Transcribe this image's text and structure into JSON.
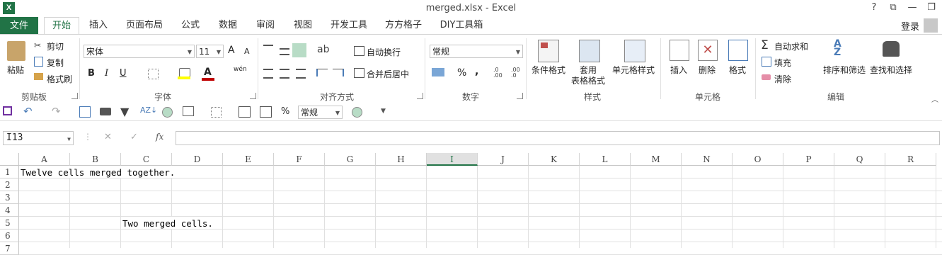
{
  "window": {
    "title": "merged.xlsx - Excel",
    "help": "?",
    "restore": "⧉",
    "minimize": "—",
    "maximize": "❐"
  },
  "tabs": [
    {
      "label": "文件"
    },
    {
      "label": "开始"
    },
    {
      "label": "插入"
    },
    {
      "label": "页面布局"
    },
    {
      "label": "公式"
    },
    {
      "label": "数据"
    },
    {
      "label": "审阅"
    },
    {
      "label": "视图"
    },
    {
      "label": "开发工具"
    },
    {
      "label": "方方格子"
    },
    {
      "label": "DIY工具箱"
    }
  ],
  "account": {
    "login": "登录"
  },
  "ribbon": {
    "clipboard": {
      "paste": "粘贴",
      "cut": "剪切",
      "copy": "复制",
      "format_painter": "格式刷",
      "label": "剪贴板"
    },
    "font": {
      "font_name": "宋体",
      "font_size": "11",
      "label": "字体",
      "grow": "A",
      "shrink": "A",
      "bold": "B",
      "italic": "I",
      "underline": "U",
      "phonetic": "wén"
    },
    "alignment": {
      "wrap_text": "自动换行",
      "merge_center": "合并后居中",
      "label": "对齐方式"
    },
    "number": {
      "format": "常规",
      "percent": "%",
      "comma": ",",
      "label": "数字"
    },
    "styles": {
      "conditional": "条件格式",
      "table_format_1": "套用",
      "table_format_2": "表格格式",
      "cell_styles": "单元格样式",
      "label": "样式"
    },
    "cells": {
      "insert": "插入",
      "delete": "删除",
      "format": "格式",
      "label": "单元格"
    },
    "editing": {
      "autosum": "自动求和",
      "fill": "填充",
      "clear": "清除",
      "sort_filter": "排序和筛选",
      "find_select": "查找和选择",
      "label": "编辑"
    }
  },
  "quickbar": {
    "format": "常规",
    "percent": "%"
  },
  "formula_bar": {
    "name_box": "I13",
    "fx": "fx",
    "cancel": "✕",
    "enter": "✓",
    "formula": ""
  },
  "columns": [
    "A",
    "B",
    "C",
    "D",
    "E",
    "F",
    "G",
    "H",
    "I",
    "J",
    "K",
    "L",
    "M",
    "N",
    "O",
    "P",
    "Q",
    "R"
  ],
  "selected_column": "I",
  "rows": [
    "1",
    "2",
    "3",
    "4",
    "5",
    "6",
    "7"
  ],
  "cells": {
    "a1": "Twelve cells merged together.",
    "c5": "Two merged cells."
  },
  "colors": {
    "accent": "#217346",
    "font_color": "#c00000",
    "fill_color": "#ffff00"
  }
}
